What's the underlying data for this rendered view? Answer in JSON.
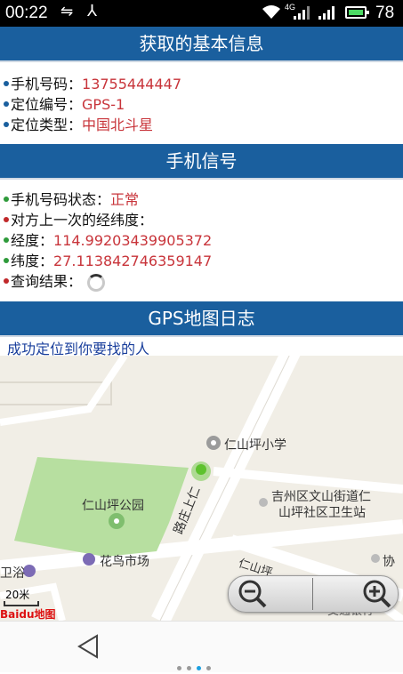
{
  "status_bar": {
    "time": "00:22",
    "network_type": "4G",
    "battery_percent": "78"
  },
  "basic_info": {
    "header": "获取的基本信息",
    "rows": [
      {
        "label": "手机号码：",
        "value": "13755444447"
      },
      {
        "label": "定位编号：",
        "value": "GPS-1"
      },
      {
        "label": "定位类型：",
        "value": "中国北斗星"
      }
    ]
  },
  "phone_signal": {
    "header": "手机信号",
    "status_label": "手机号码状态：",
    "status_value": "正常",
    "last_coords_label": "对方上一次的经纬度：",
    "longitude_label": "经度：",
    "longitude_value": "114.99203439905372",
    "latitude_label": "纬度：",
    "latitude_value": "27.113842746359147",
    "query_result_label": "查询结果："
  },
  "gps_log": {
    "header": "GPS地图日志",
    "success_message": "成功定位到你要找的人"
  },
  "map": {
    "pois": {
      "school": "仁山坪小学",
      "clinic_line1": "吉州区文山街道仁",
      "clinic_line2": "山坪社区卫生站",
      "park": "仁山坪公园",
      "flower_market": "花鸟市场",
      "bath": "卫浴",
      "road": "路庄上仁",
      "partial_right": "协",
      "partial_road": "仁山坪",
      "partial_bottom": "交通银行"
    },
    "scale_label": "20米",
    "logo_text": "Baidu地图",
    "colors": {
      "park": "#b7dfa0",
      "road": "#ffffff",
      "background": "#f1eee6",
      "marker": "#5ec22e"
    }
  },
  "colors": {
    "header_bg": "#1a5f9e",
    "value_text": "#c8343a",
    "success_text": "#1a3f9c"
  }
}
